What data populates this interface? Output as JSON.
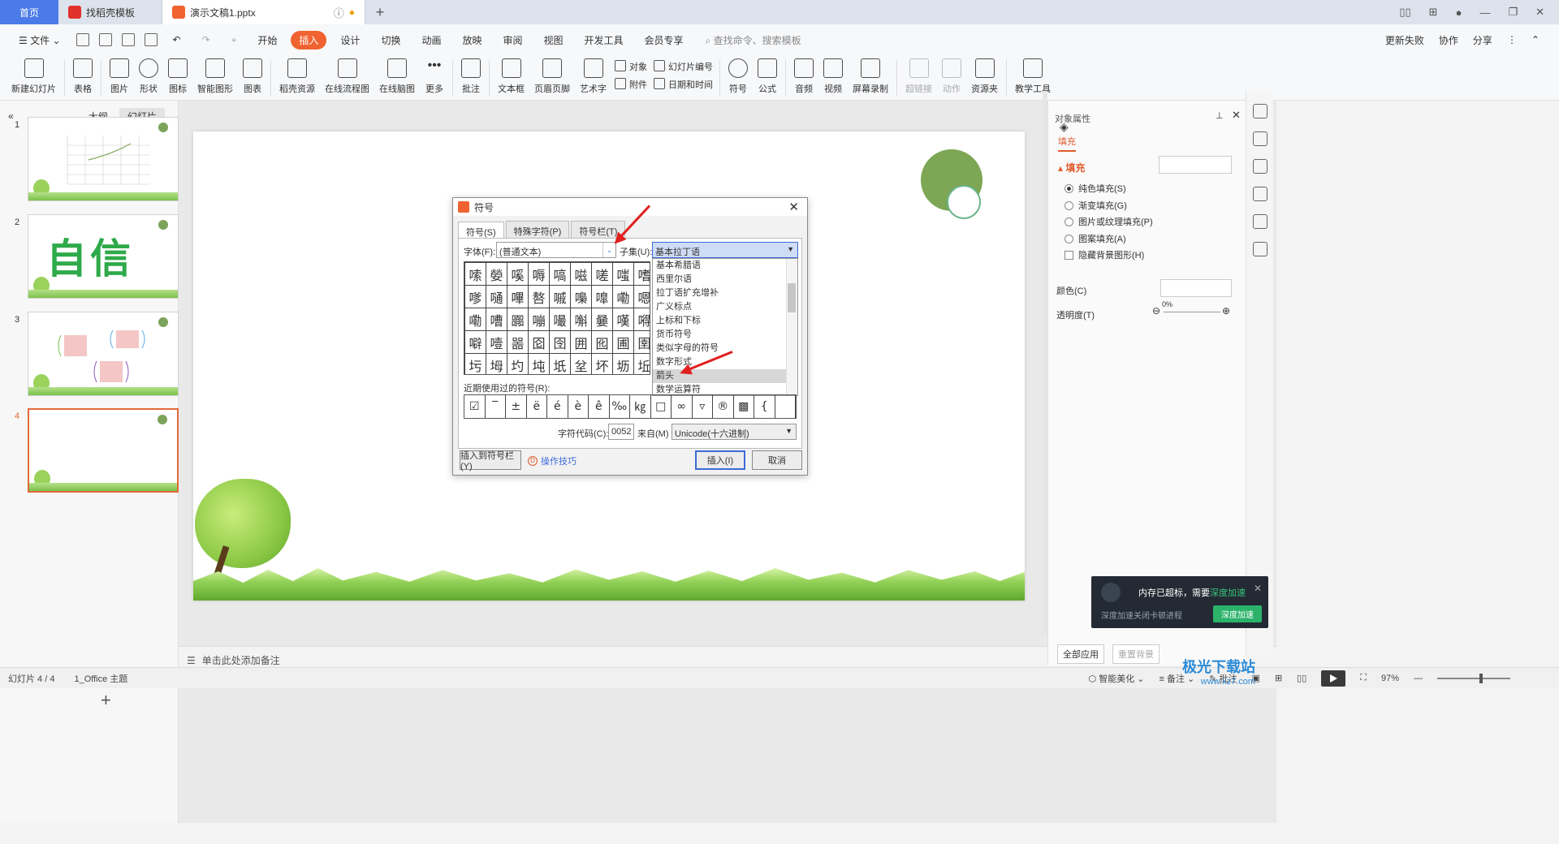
{
  "titlebar": {
    "home": "首页",
    "tabs": [
      {
        "label": "找稻壳模板"
      },
      {
        "label": "演示文稿1.pptx"
      }
    ]
  },
  "menu": {
    "file": "文件",
    "items": [
      "开始",
      "插入",
      "设计",
      "切换",
      "动画",
      "放映",
      "审阅",
      "视图",
      "开发工具",
      "会员专享"
    ],
    "active": "插入",
    "search": "查找命令、搜索模板",
    "right": [
      "更新失败",
      "协作",
      "分享"
    ]
  },
  "ribbon": {
    "buttons": [
      "新建幻灯片",
      "表格",
      "图片",
      "形状",
      "图标",
      "智能图形",
      "图表",
      "稻壳资源",
      "在线流程图",
      "在线脑图",
      "更多",
      "批注",
      "文本框",
      "页眉页脚",
      "艺术字"
    ],
    "pair1": [
      "对象",
      "附件"
    ],
    "pair2": [
      "幻灯片编号",
      "日期和时间"
    ],
    "buttons2": [
      "符号",
      "公式",
      "音频",
      "视频",
      "屏幕录制"
    ],
    "dim_buttons": [
      "超链接",
      "动作"
    ],
    "buttons3": [
      "资源夹",
      "教学工具"
    ]
  },
  "left_panel": {
    "tabs": [
      "大纲",
      "幻灯片"
    ],
    "active_tab": "幻灯片",
    "slides": [
      "1",
      "2",
      "3",
      "4"
    ],
    "slide2_text": "自信"
  },
  "notes_placeholder": "单击此处添加备注",
  "dialog": {
    "title": "符号",
    "tabs": [
      "符号(S)",
      "特殊字符(P)",
      "符号栏(T)"
    ],
    "font_label": "字体(F):",
    "font_value": "(普通文本)",
    "subset_label": "子集(U):",
    "subset_value": "基本拉丁语",
    "subset_options": [
      "基本希腊语",
      "西里尔语",
      "拉丁语扩充增补",
      "广义标点",
      "上标和下标",
      "货币符号",
      "类似字母的符号",
      "数字形式",
      "箭头",
      "数学运算符"
    ],
    "subset_highlight": "箭头",
    "grid_chars": [
      "嗦",
      "嫈",
      "嗘",
      "嗕",
      "嗃",
      "嗞",
      "嗟",
      "嗤",
      "嗜",
      "嗲",
      "嗵",
      "嗶",
      "嗸",
      "嘁",
      "嘄",
      "嘷",
      "嘞",
      "嗯",
      "嘞",
      "嘈",
      "嚻",
      "嘣",
      "嘬",
      "嘝",
      "嘦",
      "嘆",
      "嘚",
      "噼",
      "噎",
      "噐",
      "囵",
      "囹",
      "囲",
      "囮",
      "圃",
      "圉",
      "圬",
      "坶",
      "圴",
      "坉",
      "坁",
      "坌",
      "坏",
      "坜",
      "坵"
    ],
    "recent_label": "近期使用过的符号(R):",
    "recent_chars": [
      "☑",
      "‾",
      "±",
      "ë",
      "é",
      "è",
      "ê",
      "‰",
      "㎏",
      "□",
      "∞",
      "▿",
      "®",
      "▩",
      "{",
      ""
    ],
    "code_label": "字符代码(C):",
    "code_value": "0052",
    "from_label": "来自(M)",
    "from_value": "Unicode(十六进制)",
    "insert_to_bar": "插入到符号栏(Y)",
    "tips": "操作技巧",
    "insert": "插入(I)",
    "cancel": "取消"
  },
  "right_panel": {
    "title": "对象属性",
    "tab": "填充",
    "section": "填充",
    "options": [
      "纯色填充(S)",
      "渐变填充(G)",
      "图片或纹理填充(P)",
      "图案填充(A)"
    ],
    "hide_bg": "隐藏背景图形(H)",
    "color_label": "颜色(C)",
    "transparency_label": "透明度(T)",
    "transparency_value": "0%",
    "apply_all": "全部应用",
    "reset_bg": "重置背景"
  },
  "notification": {
    "title_prefix": "内存已超标，需要",
    "title_link": "深度加速",
    "subtitle": "深度加速关闭卡顿进程",
    "button": "深度加速"
  },
  "status": {
    "slide_count": "幻灯片 4 / 4",
    "theme": "1_Office 主题",
    "beautify": "智能美化",
    "notes": "备注",
    "comments": "批注",
    "zoom": "97%"
  },
  "watermark": {
    "name": "极光下载站",
    "url": "www.xz7.com"
  },
  "colors": {
    "accent": "#f0622f",
    "tab_active": "#4a7be8",
    "slide_green": "#7da655",
    "arrow": "#e01f1f"
  }
}
